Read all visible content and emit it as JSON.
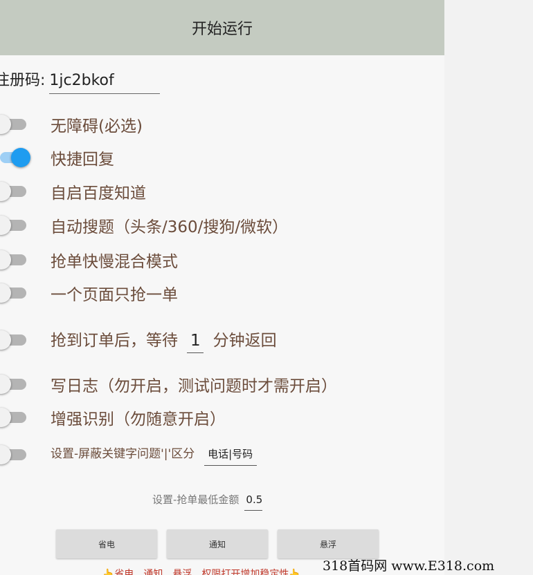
{
  "header": {
    "title": "开始运行"
  },
  "registration": {
    "label": "注册码:",
    "value": "1jc2bkof"
  },
  "options": [
    {
      "label": "无障碍(必选)",
      "on": false
    },
    {
      "label": "快捷回复",
      "on": true
    },
    {
      "label": "自启百度知道",
      "on": false
    },
    {
      "label": "自动搜题（头条/360/搜狗/微软）",
      "on": false
    },
    {
      "label": "抢单快慢混合模式",
      "on": false
    },
    {
      "label": "一个页面只抢一单",
      "on": false
    },
    {
      "label_before": "抢到订单后，等待",
      "value": "1",
      "label_after": "分钟返回",
      "on": false
    },
    {
      "label": "写日志（勿开启，测试问题时才需开启）",
      "on": false
    },
    {
      "label": "增强识别（勿随意开启）",
      "on": false
    },
    {
      "label": "设置-屏蔽关键字问题'|'区分",
      "value": "电话|号码",
      "on": false
    }
  ],
  "min_amount": {
    "label": "设置-抢单最低金额",
    "value": "0.5"
  },
  "buttons": {
    "power": "省电",
    "notify": "通知",
    "float": "悬浮"
  },
  "hint": "👆省电、通知、悬浮、权限打开增加稳定性👆",
  "watermark": "318首码网 www.E318.com"
}
